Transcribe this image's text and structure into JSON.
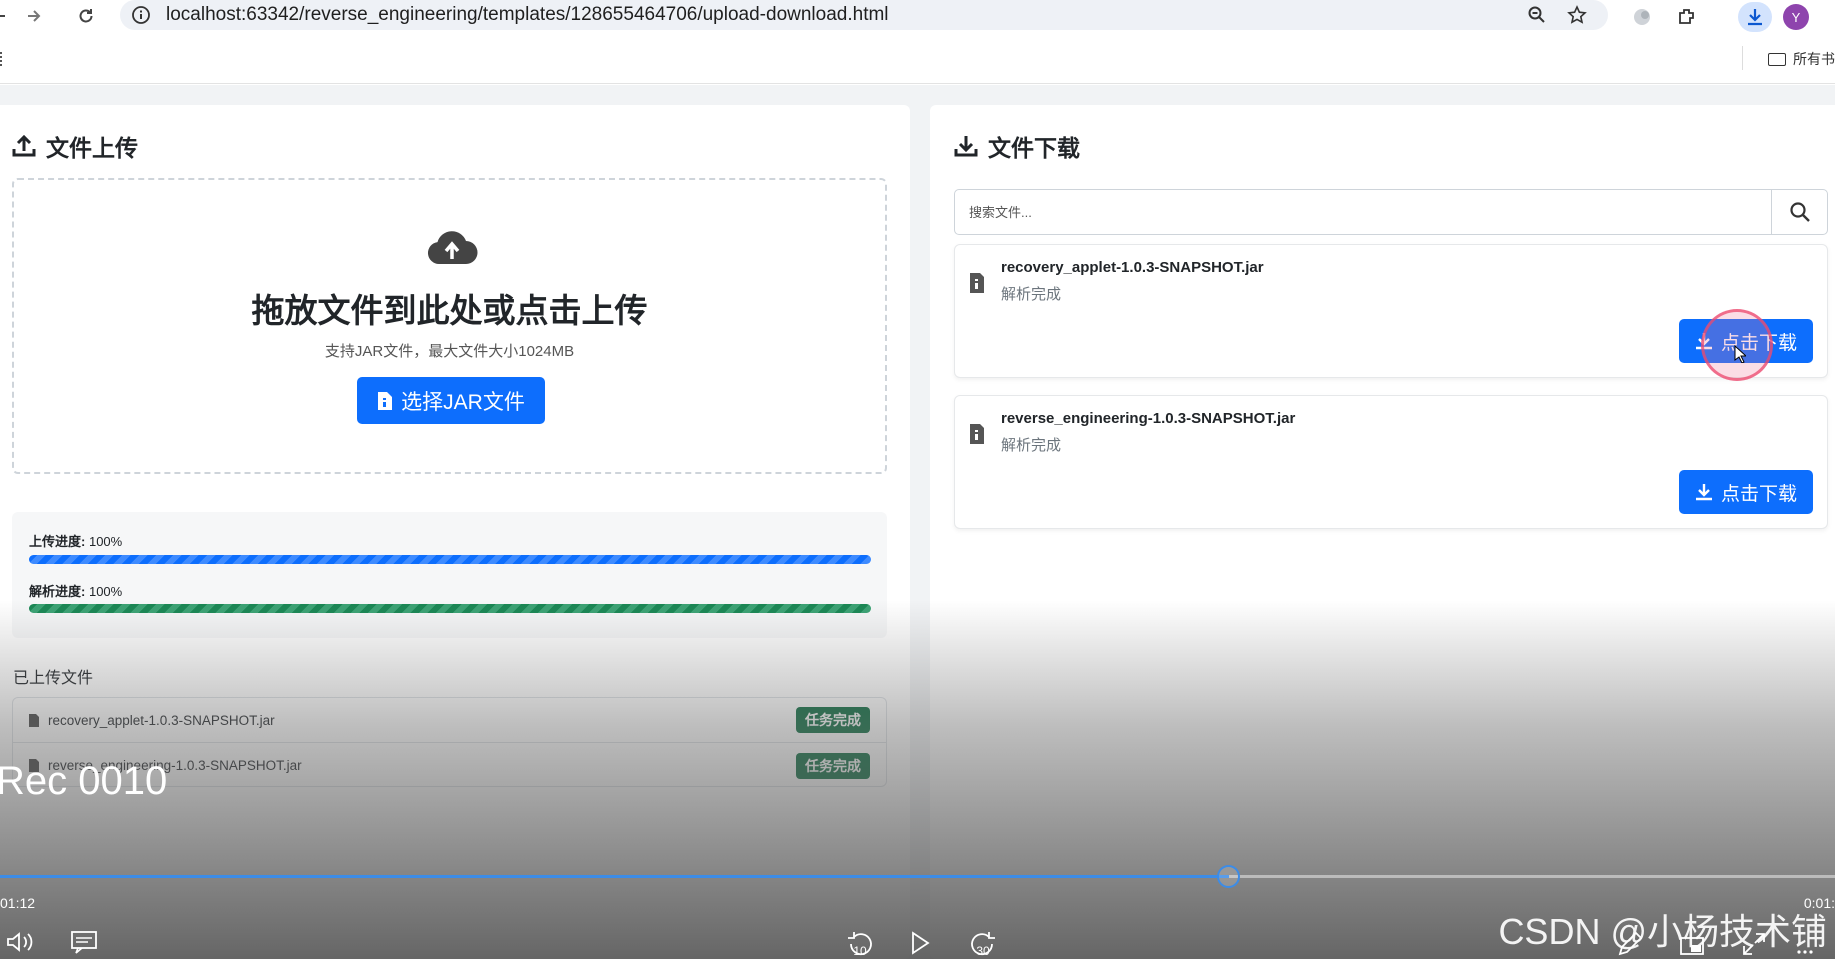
{
  "browser": {
    "url": "localhost:63342/reverse_engineering/templates/128655464706/upload-download.html",
    "avatar_letter": "Y",
    "bookmark_label": "所有书",
    "icons": {
      "back": "back-arrow-icon",
      "forward": "forward-arrow-icon",
      "reload": "reload-icon",
      "info": "info-icon",
      "zoom": "zoom-icon",
      "star": "bookmark-star-icon",
      "download": "download-icon",
      "extensions": "extensions-icon"
    }
  },
  "upload": {
    "heading": "文件上传",
    "drop_title": "拖放文件到此处或点击上传",
    "drop_sub": "支持JAR文件，最大文件大小1024MB",
    "choose_button": "选择JAR文件",
    "upload_progress_label": "上传进度:",
    "upload_progress_value": "100%",
    "upload_progress": 1.0,
    "parse_progress_label": "解析进度:",
    "parse_progress_value": "100%",
    "parse_progress": 1.0,
    "uploaded_title": "已上传文件",
    "files": [
      {
        "name": "recovery_applet-1.0.3-SNAPSHOT.jar",
        "status": "任务完成"
      },
      {
        "name": "reverse_engineering-1.0.3-SNAPSHOT.jar",
        "status": "任务完成"
      }
    ]
  },
  "download": {
    "heading": "文件下载",
    "search_placeholder": "搜索文件...",
    "files": [
      {
        "name": "recovery_applet-1.0.3-SNAPSHOT.jar",
        "status": "解析完成",
        "button": "点击下载"
      },
      {
        "name": "reverse_engineering-1.0.3-SNAPSHOT.jar",
        "status": "解析完成",
        "button": "点击下载"
      }
    ]
  },
  "player": {
    "title": "Rec 0010",
    "current_time": "01:12",
    "end_time": "0:01:",
    "played_fraction": 0.67,
    "skip_back": "10",
    "skip_forward": "30",
    "watermark": "CSDN @小杨技术铺"
  },
  "colors": {
    "primary": "#0d6efd",
    "success_dark": "#0a6b3f",
    "progress_green": "#198754"
  }
}
